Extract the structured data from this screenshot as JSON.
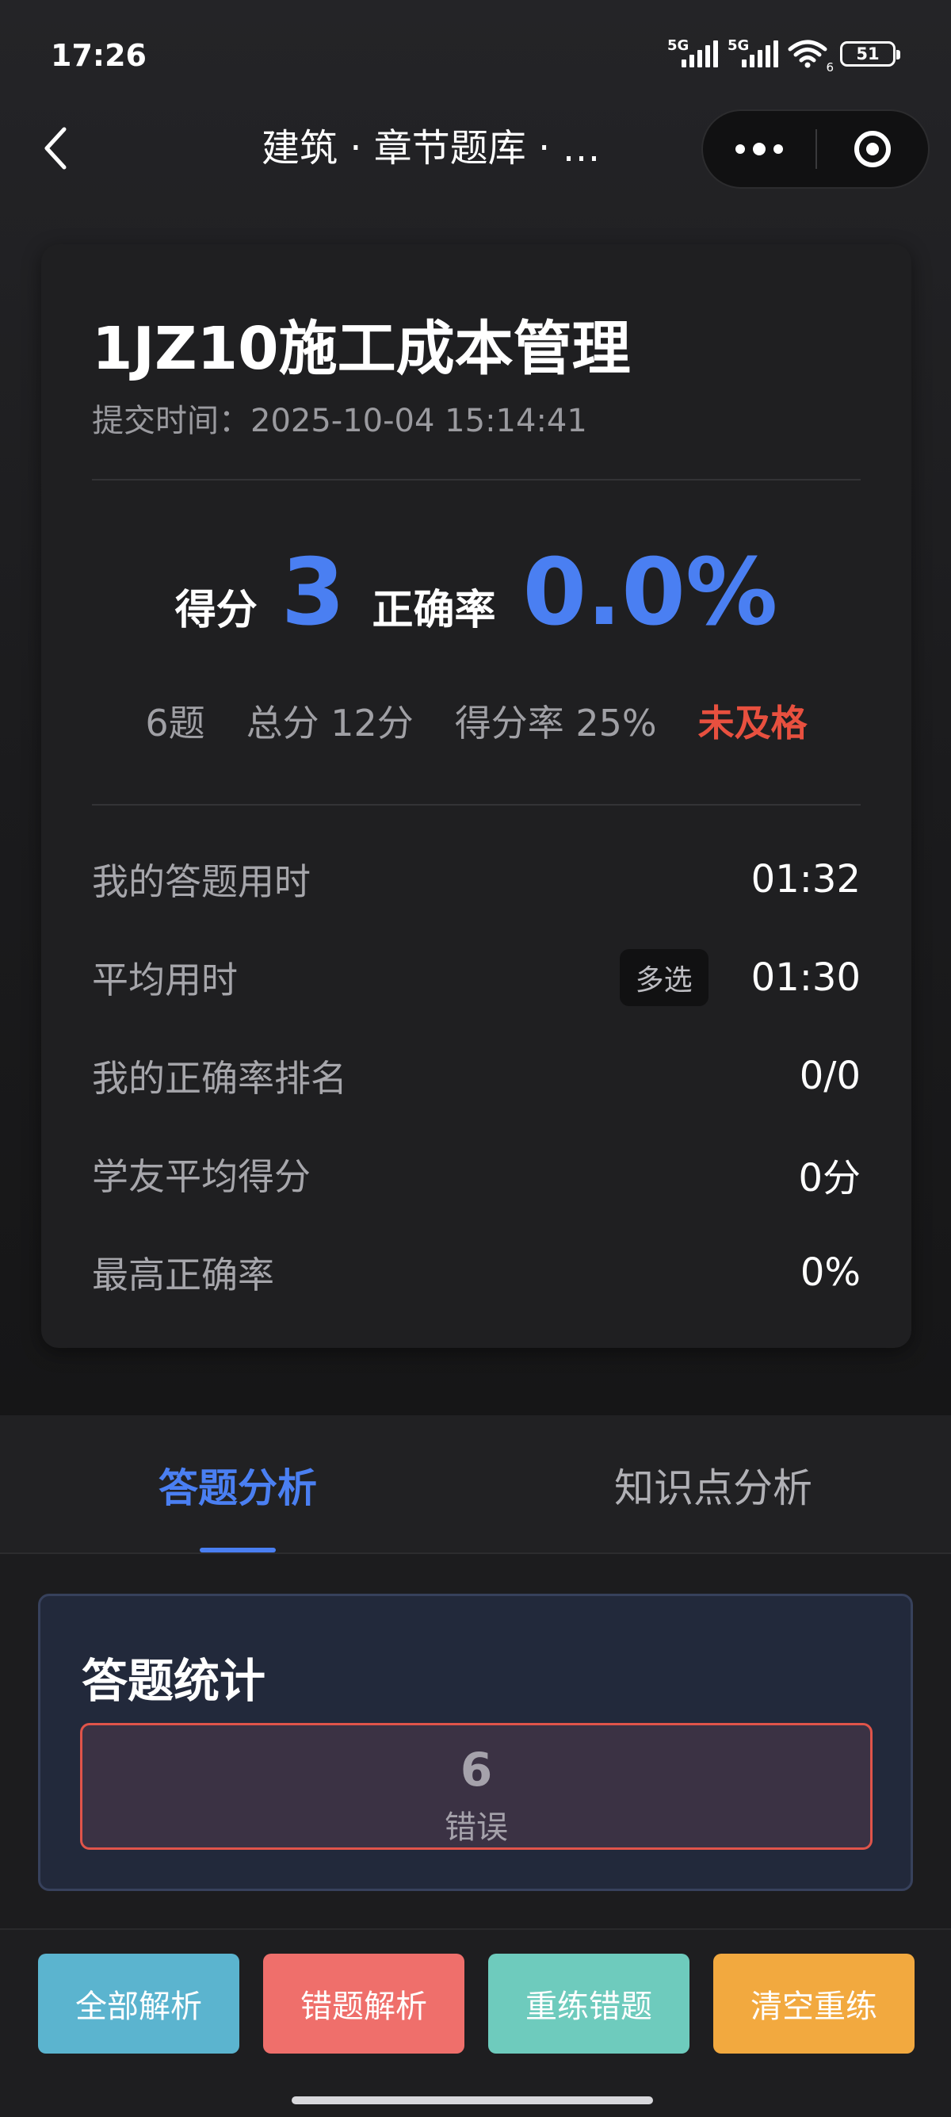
{
  "status_bar": {
    "time": "17:26",
    "signal_1_label": "5G",
    "signal_2_label": "5G",
    "wifi_label": "6",
    "battery_level": "51"
  },
  "nav": {
    "title": "建筑 · 章节题库 · …",
    "back_icon": "chevron-left-icon",
    "more_icon": "more-dots-icon",
    "close_icon": "target-icon"
  },
  "result": {
    "title": "1JZ10施工成本管理",
    "submit_time": "提交时间：2025-10-04 15:14:41",
    "score_label": "得分",
    "score_value": "3",
    "accuracy_label": "正确率",
    "accuracy_value": "0.0%",
    "question_count": "6题",
    "total_score": "总分 12分",
    "score_rate": "得分率 25%",
    "pass_status": "未及格",
    "stats": [
      {
        "label": "我的答题用时",
        "value": "01:32"
      },
      {
        "label": "平均用时",
        "tag": "多选",
        "value": "01:30"
      },
      {
        "label": "我的正确率排名",
        "value": "0/0"
      },
      {
        "label": "学友平均得分",
        "value": "0分"
      },
      {
        "label": "最高正确率",
        "value": "0%"
      }
    ]
  },
  "tabs": [
    {
      "label": "答题分析",
      "active": true
    },
    {
      "label": "知识点分析",
      "active": false
    }
  ],
  "answer_stats": {
    "title": "答题统计",
    "wrong_count": "6",
    "wrong_label": "错误"
  },
  "actions": [
    {
      "label": "全部解析",
      "color": "#5bb4cf"
    },
    {
      "label": "错题解析",
      "color": "#ef6f6b"
    },
    {
      "label": "重练错题",
      "color": "#6ecbbd"
    },
    {
      "label": "清空重练",
      "color": "#f2a93f"
    }
  ],
  "colors": {
    "accent": "#4a7ff2",
    "fail": "#e8503f",
    "background": "#1c1c1e"
  }
}
